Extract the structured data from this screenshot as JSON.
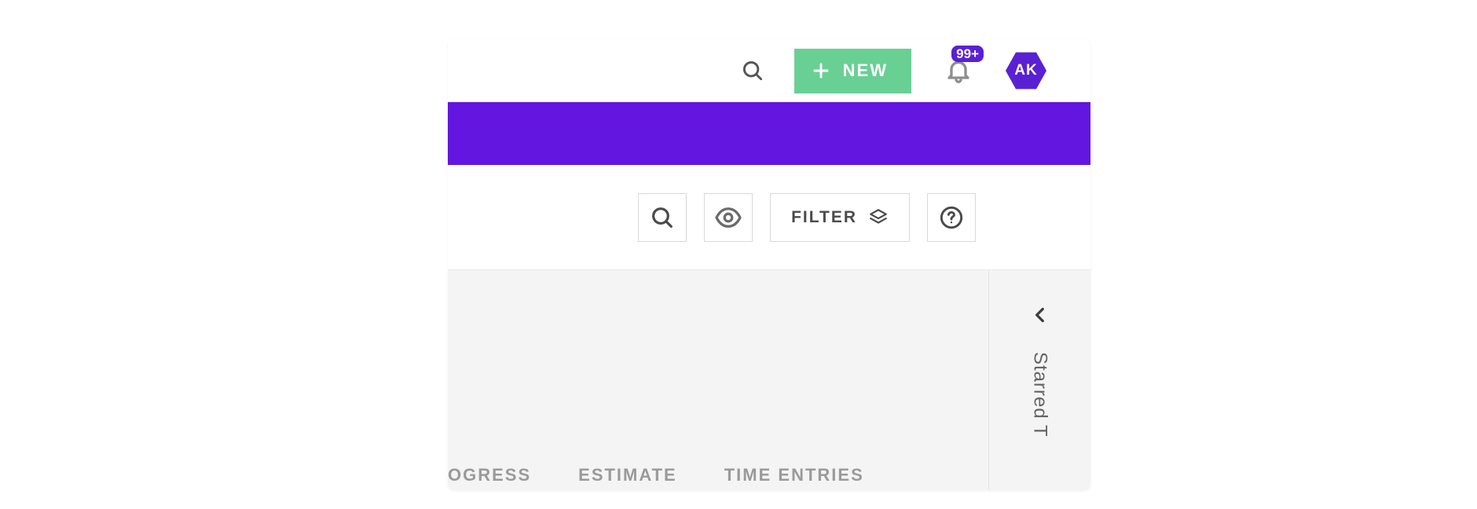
{
  "colors": {
    "accent_purple": "#6316e0",
    "badge_purple": "#5a20d4",
    "new_green": "#69d094"
  },
  "topbar": {
    "new_label": "NEW",
    "notification_badge": "99+",
    "avatar_initials": "AK"
  },
  "toolbar": {
    "filter_label": "FILTER"
  },
  "columns": {
    "col1_partial": "OGRESS",
    "col2": "ESTIMATE",
    "col3": "TIME ENTRIES"
  },
  "side_panel": {
    "label_partial": "Starred T"
  }
}
